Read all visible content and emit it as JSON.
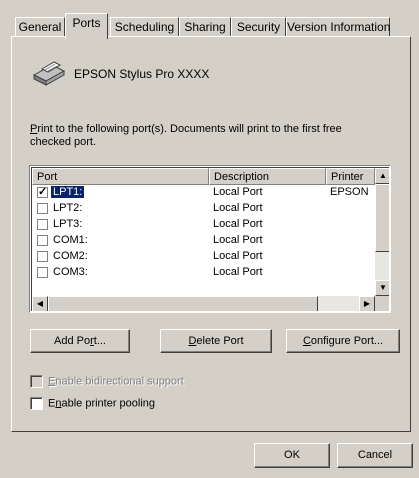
{
  "tabs": [
    {
      "label": "General",
      "active": false
    },
    {
      "label": "Ports",
      "active": true
    },
    {
      "label": "Scheduling",
      "active": false
    },
    {
      "label": "Sharing",
      "active": false
    },
    {
      "label": "Security",
      "active": false
    },
    {
      "label": "Version Information",
      "active": false
    }
  ],
  "printer": {
    "name": "EPSON Stylus Pro XXXX",
    "icon": "printer-icon"
  },
  "instructions": {
    "first_letter": "P",
    "rest_line1": "rint to the following port(s).  Documents will print to the first free",
    "line2": "checked port."
  },
  "ports": {
    "columns": [
      "Port",
      "Description",
      "Printer"
    ],
    "rows": [
      {
        "port": "LPT1:",
        "description": "Local Port",
        "printer": "EPSON",
        "checked": true,
        "selected": true
      },
      {
        "port": "LPT2:",
        "description": "Local Port",
        "printer": "",
        "checked": false,
        "selected": false
      },
      {
        "port": "LPT3:",
        "description": "Local Port",
        "printer": "",
        "checked": false,
        "selected": false
      },
      {
        "port": "COM1:",
        "description": "Local Port",
        "printer": "",
        "checked": false,
        "selected": false
      },
      {
        "port": "COM2:",
        "description": "Local Port",
        "printer": "",
        "checked": false,
        "selected": false
      },
      {
        "port": "COM3:",
        "description": "Local Port",
        "printer": "",
        "checked": false,
        "selected": false
      }
    ]
  },
  "buttons": {
    "add_port_pre": "Add Po",
    "add_port_key": "r",
    "add_port_post": "t...",
    "delete_port_key": "D",
    "delete_port_post": "elete Port",
    "configure_port_key": "C",
    "configure_port_post": "onfigure Port..."
  },
  "options": {
    "bidirectional_key": "E",
    "bidirectional_rest": "nable bidirectional support",
    "bidirectional_enabled": false,
    "pooling_key": "n",
    "pooling_pre": "E",
    "pooling_rest": "able printer pooling",
    "pooling_checked": false
  },
  "footer": {
    "ok": "OK",
    "cancel": "Cancel"
  }
}
